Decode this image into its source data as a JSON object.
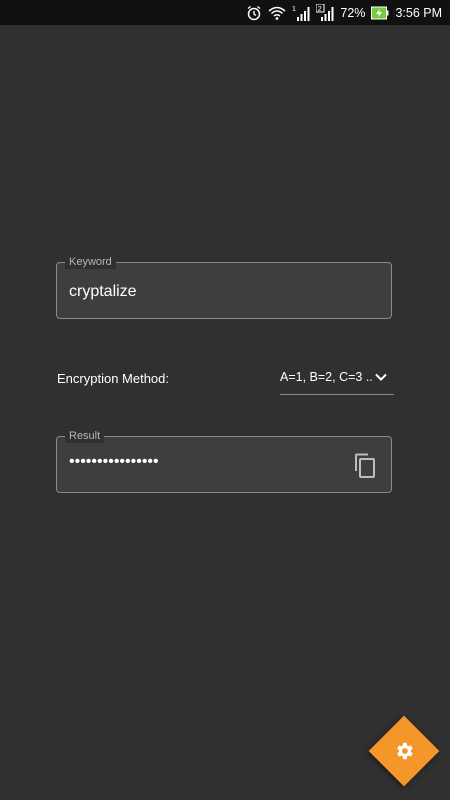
{
  "status_bar": {
    "icons": [
      "alarm-icon",
      "wifi-icon",
      "signal-sim1-icon",
      "signal-sim2-icon",
      "battery-charging-icon"
    ],
    "sim1_label": "1",
    "sim2_label": "2",
    "battery_percent": "72%",
    "time": "3:56 PM"
  },
  "keyword_field": {
    "label": "Keyword",
    "value": "cryptalize"
  },
  "encryption": {
    "label": "Encryption Method:",
    "selected": "A=1, B=2, C=3 ..",
    "arrow_icon": "chevron-down-icon"
  },
  "result_field": {
    "label": "Result",
    "value": "••••••••••••••••",
    "copy_icon": "copy-icon"
  },
  "fab": {
    "icon": "gear-icon",
    "color": "#f5962a"
  },
  "colors": {
    "background": "#303030",
    "status_bar": "#111111",
    "accent": "#f5962a",
    "battery": "#7ac943"
  }
}
